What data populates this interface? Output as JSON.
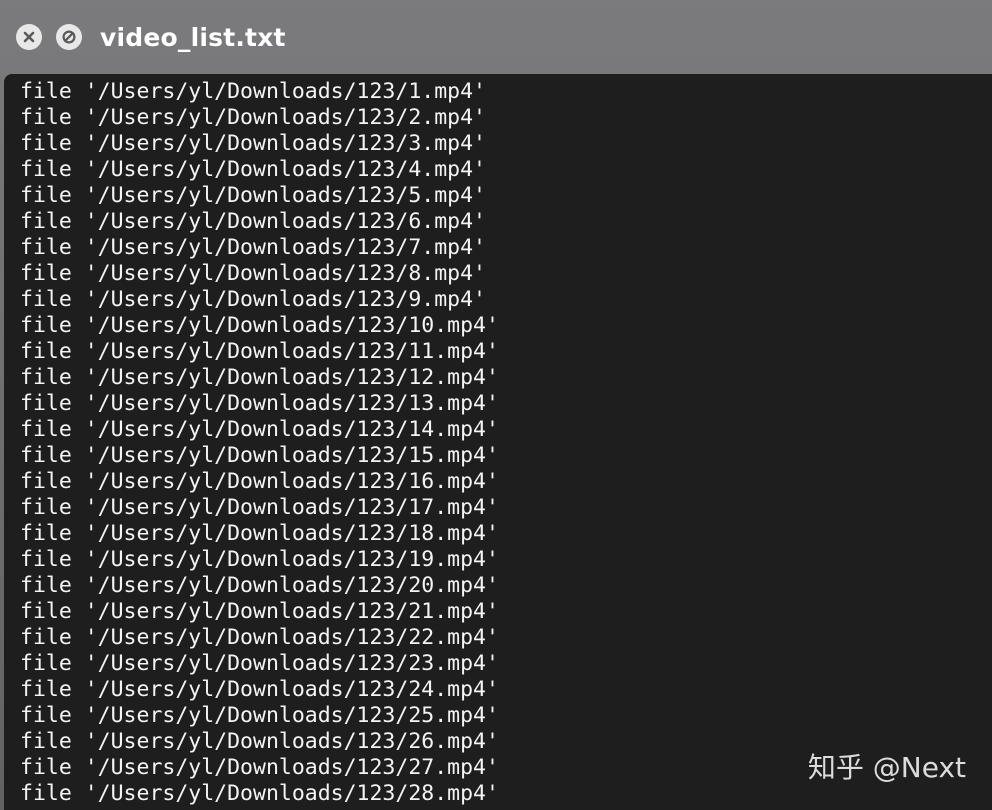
{
  "window": {
    "title": "video_list.txt",
    "close_icon": "close-icon",
    "zoom_icon": "fullscreen-icon"
  },
  "editor": {
    "lines": [
      "file '/Users/yl/Downloads/123/1.mp4'",
      "file '/Users/yl/Downloads/123/2.mp4'",
      "file '/Users/yl/Downloads/123/3.mp4'",
      "file '/Users/yl/Downloads/123/4.mp4'",
      "file '/Users/yl/Downloads/123/5.mp4'",
      "file '/Users/yl/Downloads/123/6.mp4'",
      "file '/Users/yl/Downloads/123/7.mp4'",
      "file '/Users/yl/Downloads/123/8.mp4'",
      "file '/Users/yl/Downloads/123/9.mp4'",
      "file '/Users/yl/Downloads/123/10.mp4'",
      "file '/Users/yl/Downloads/123/11.mp4'",
      "file '/Users/yl/Downloads/123/12.mp4'",
      "file '/Users/yl/Downloads/123/13.mp4'",
      "file '/Users/yl/Downloads/123/14.mp4'",
      "file '/Users/yl/Downloads/123/15.mp4'",
      "file '/Users/yl/Downloads/123/16.mp4'",
      "file '/Users/yl/Downloads/123/17.mp4'",
      "file '/Users/yl/Downloads/123/18.mp4'",
      "file '/Users/yl/Downloads/123/19.mp4'",
      "file '/Users/yl/Downloads/123/20.mp4'",
      "file '/Users/yl/Downloads/123/21.mp4'",
      "file '/Users/yl/Downloads/123/22.mp4'",
      "file '/Users/yl/Downloads/123/23.mp4'",
      "file '/Users/yl/Downloads/123/24.mp4'",
      "file '/Users/yl/Downloads/123/25.mp4'",
      "file '/Users/yl/Downloads/123/26.mp4'",
      "file '/Users/yl/Downloads/123/27.mp4'",
      "file '/Users/yl/Downloads/123/28.mp4'"
    ]
  },
  "watermark": {
    "text": "知乎 @Next"
  },
  "colors": {
    "titlebar": "#6e6e70",
    "editor_bg": "#1e1e1e",
    "text": "#f4f4f4",
    "title_button": "#e8e8e8"
  }
}
